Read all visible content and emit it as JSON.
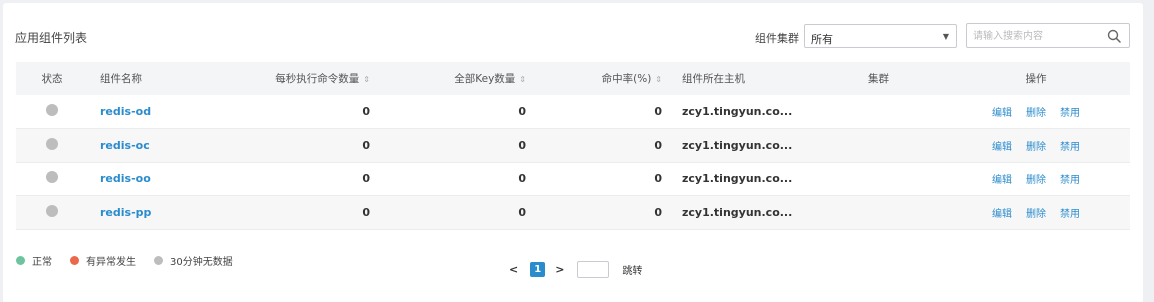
{
  "title": "应用组件列表",
  "filter": {
    "cluster_label": "组件集群",
    "cluster_value": "所有",
    "search_placeholder": "请输入搜索内容"
  },
  "table": {
    "headers": {
      "status": "状态",
      "name": "组件名称",
      "ops_per_sec": "每秒执行命令数量",
      "keys": "全部Key数量",
      "hit_rate": "命中率(%)",
      "host": "组件所在主机",
      "cluster": "集群",
      "actions": "操作"
    },
    "sort_glyph": "⇕",
    "rows": [
      {
        "name": "redis-od",
        "ops": "0",
        "keys": "0",
        "hit": "0",
        "host": "zcy1.tingyun.co...",
        "cluster": "",
        "status": "no-data"
      },
      {
        "name": "redis-oc",
        "ops": "0",
        "keys": "0",
        "hit": "0",
        "host": "zcy1.tingyun.co...",
        "cluster": "",
        "status": "no-data"
      },
      {
        "name": "redis-oo",
        "ops": "0",
        "keys": "0",
        "hit": "0",
        "host": "zcy1.tingyun.co...",
        "cluster": "",
        "status": "no-data"
      },
      {
        "name": "redis-pp",
        "ops": "0",
        "keys": "0",
        "hit": "0",
        "host": "zcy1.tingyun.co...",
        "cluster": "",
        "status": "no-data"
      }
    ],
    "actions": {
      "edit": "编辑",
      "delete": "删除",
      "disable": "禁用"
    }
  },
  "legend": [
    {
      "label": "正常",
      "color": "#6cc59e"
    },
    {
      "label": "有异常发生",
      "color": "#e9694a"
    },
    {
      "label": "30分钟无数据",
      "color": "#bdbdbd"
    }
  ],
  "pager": {
    "prev": "<",
    "next": ">",
    "current": "1",
    "jump_label": "跳转"
  }
}
